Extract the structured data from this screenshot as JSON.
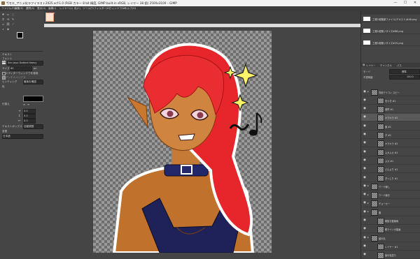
{
  "titlebar": {
    "title": "*[モエ_アニメ化ラフイラスト2025.xcf-1.0 (RGB カラー 8 bit 精度, GIMP built-in sRGB, レイヤー 38 個) 2500x3100 – GIMP",
    "minimize": "—",
    "maximize": "☐",
    "close": "✕"
  },
  "menu": [
    "ファイル(F)",
    "編集(E)",
    "選択(S)",
    "表示(V)",
    "画像(I)",
    "レイヤー(L)",
    "色(C)",
    "ツール(T)",
    "フィルター(R)",
    "ウィンドウ(W)",
    "ヘルプ(H)"
  ],
  "tool_options": {
    "title": "テキスト",
    "font_label": "フォント",
    "font_value": "Sen Joyo Dotted Heavy",
    "size_label": "サイズ",
    "size_value": "60",
    "size_unit": "px",
    "editor_label": "エディターウィンドウを使用",
    "antialias_label": "アンチエイリアス",
    "hinting_label": "ヒンティング",
    "hinting_value": "最後を確認",
    "color_label": "色",
    "justify_label": "行揃え",
    "indent_label": "インデント",
    "line_spacing_label": "行間",
    "letter_spacing_label": "文字間",
    "indent_value": "0.0",
    "line_value": "0.0",
    "letter_value": "0.0",
    "box_label": "テキストボックス",
    "box_value": "自動調整",
    "lang_label": "言語",
    "lang_value": "日本語"
  },
  "history": [
    "工程1段階部ファイル(テキスト)#46.png",
    "工程1段階リサイズ#88.png",
    "工程1段階リサイズ#25.png"
  ],
  "layers_panel": {
    "tabs": [
      "レイヤー",
      "チャンネル",
      "パス"
    ],
    "mode_label": "モード",
    "mode_value": "標準",
    "opacity_label": "不透明度",
    "opacity_value": "100.0",
    "layers": [
      {
        "name": "背景アイコン スピー",
        "depth": 1,
        "group": true
      },
      {
        "name": "光つき #1",
        "depth": 2
      },
      {
        "name": "音符 #1",
        "depth": 2
      },
      {
        "name": "キラキラ #1",
        "depth": 2
      },
      {
        "name": "顔 #1",
        "depth": 2
      },
      {
        "name": "汗 #1",
        "depth": 2
      },
      {
        "name": "キラキラ #2",
        "depth": 2
      },
      {
        "name": "ムカムカ #1",
        "depth": 2
      },
      {
        "name": "ムカ #1",
        "depth": 2
      },
      {
        "name": "どんより #1",
        "depth": 2
      },
      {
        "name": "ぎっしり #1",
        "depth": 2
      },
      {
        "name": "ワード線し",
        "depth": 1,
        "group": true
      },
      {
        "name": "ワード線き",
        "depth": 1,
        "group": true
      },
      {
        "name": "チョーカー",
        "depth": 1,
        "group": true
      },
      {
        "name": "服",
        "depth": 1,
        "group": true
      },
      {
        "name": "瞳描き直線用",
        "depth": 2
      },
      {
        "name": "瞳ラインの描画",
        "depth": 2
      },
      {
        "name": "髪の毛",
        "depth": 1,
        "group": true
      },
      {
        "name": "レイヤー #1",
        "depth": 2
      },
      {
        "name": "髪の色塗り",
        "depth": 2
      }
    ]
  }
}
